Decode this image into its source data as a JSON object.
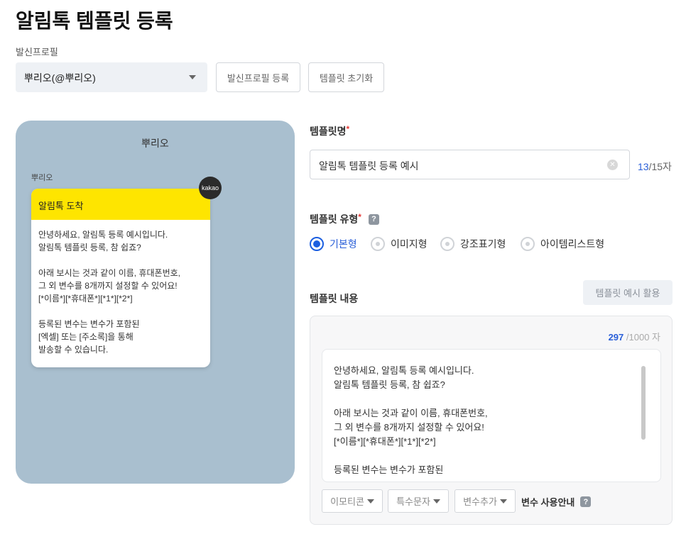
{
  "page": {
    "title": "알림톡 템플릿 등록"
  },
  "profile": {
    "label": "발신프로필",
    "selected": "뿌리오(@뿌리오)",
    "register_button": "발신프로필 등록",
    "reset_button": "템플릿 초기화"
  },
  "preview": {
    "header": "뿌리오",
    "sender": "뿌리오",
    "badge": "kakao",
    "bubble_title": "알림톡 도착",
    "bubble_body": "안녕하세요, 알림톡 등록 예시입니다.\n알림톡 템플릿 등록, 참 쉽죠?\n\n아래 보시는 것과 같이 이름, 휴대폰번호,\n그 외 변수를 8개까지 설정할 수 있어요!\n[*이름*][*휴대폰*][*1*][*2*]\n\n등록된 변수는 변수가 포함된\n[엑셀] 또는 [주소록]을 통해\n발송할 수 있습니다."
  },
  "template_name": {
    "label": "템플릿명",
    "required": "*",
    "value": "알림톡 템플릿 등록 예시",
    "count": "13",
    "max": "/15자"
  },
  "template_type": {
    "label": "템플릿 유형",
    "required": "*",
    "help": "?",
    "options": [
      "기본형",
      "이미지형",
      "강조표기형",
      "아이템리스트형"
    ],
    "selected": "기본형"
  },
  "template_content": {
    "label": "템플릿 내용",
    "example_button": "템플릿 예시 활용",
    "count": "297",
    "max": " /1000 자",
    "value": "안녕하세요, 알림톡 등록 예시입니다.\n알림톡 템플릿 등록, 참 쉽죠?\n\n아래 보시는 것과 같이 이름, 휴대폰번호,\n그 외 변수를 8개까지 설정할 수 있어요!\n[*이름*][*휴대폰*][*1*][*2*]\n\n등록된 변수는 변수가 포함된",
    "emoticon": "이모티콘",
    "special_char": "특수문자",
    "add_variable": "변수추가",
    "variable_guide": "변수 사용안내",
    "help": "?"
  },
  "colors": {
    "accent": "#1c5fe0",
    "kakao_yellow": "#fee500",
    "preview_bg": "#a9bfcf"
  }
}
